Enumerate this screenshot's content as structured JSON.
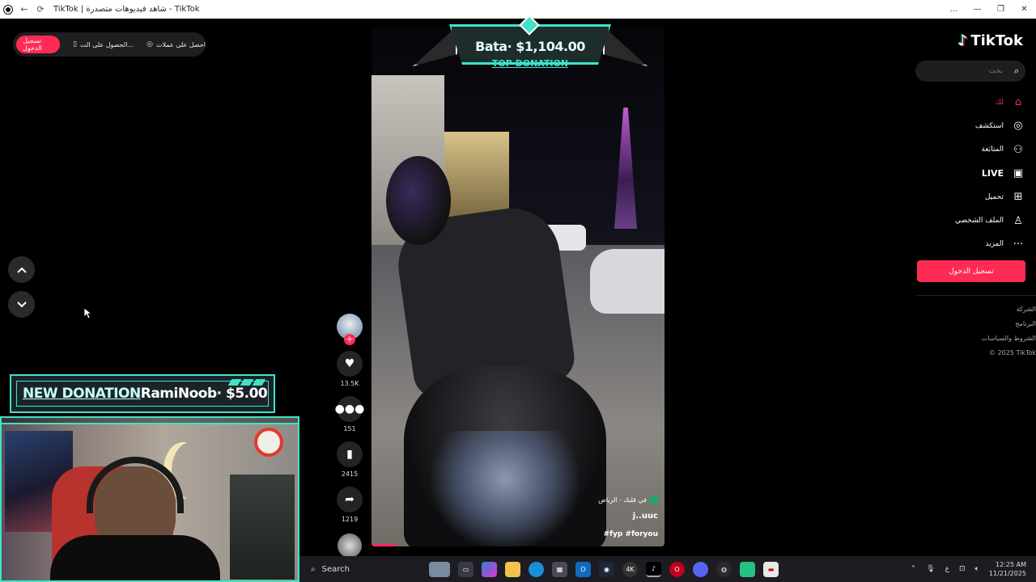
{
  "window": {
    "title": "TikTok | شاهد فيديوهات متصدرة - TikTok",
    "controls": [
      "…",
      "—",
      "❐",
      "✕"
    ]
  },
  "topbar": {
    "login_label": "تسجيل الدخول",
    "get_app_label": "الحصول على الت...",
    "get_coins_label": "احصل على عملات"
  },
  "overlay": {
    "top_donation_amount": "Bata· $1,104.00",
    "top_donation_label": "TOP DONATION",
    "new_donation_label": "NEW DONATION",
    "new_donation_amount": "RamiNoob· $5.00"
  },
  "video": {
    "location": "في قلبك · الرياض",
    "author": "j..uuc",
    "hashtags": "#fyp #foryou"
  },
  "actions": {
    "likes": "13.5K",
    "comments": "151",
    "saves": "2415",
    "shares": "1219"
  },
  "sidebar": {
    "logo_text": "TikTok",
    "search_placeholder": "بحث",
    "items": [
      {
        "label": "لك",
        "icon": "home-icon"
      },
      {
        "label": "استكشف",
        "icon": "compass-icon"
      },
      {
        "label": "المتابَعة",
        "icon": "following-icon"
      },
      {
        "label": "LIVE",
        "icon": "live-icon"
      },
      {
        "label": "تحميل",
        "icon": "upload-icon"
      },
      {
        "label": "الملف الشخصي",
        "icon": "profile-icon"
      },
      {
        "label": "المزيد",
        "icon": "more-icon"
      }
    ],
    "signin_label": "تسجيل الدخول",
    "footer": [
      "الشركة",
      "البرنامج",
      "الشروط والسياسات",
      "© 2025 TikTok"
    ]
  },
  "taskbar": {
    "search_label": "Search",
    "time": "12:25 AM",
    "date": "11/21/2025",
    "lang": "ع"
  },
  "colors": {
    "accent": "#fe2c55",
    "overlay_teal": "#3fe3c8"
  }
}
